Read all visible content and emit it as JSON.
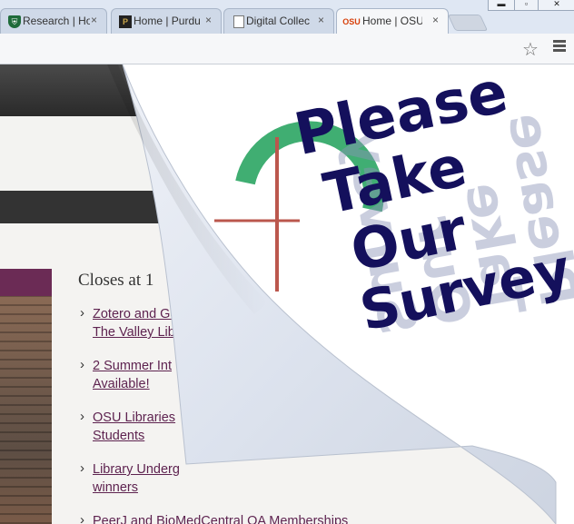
{
  "browser": {
    "tabs": [
      {
        "title": "Research | Ho",
        "icon": "tulane-shield-icon",
        "active": false
      },
      {
        "title": "Home | Purdu",
        "icon": "purdue-p-icon",
        "active": false
      },
      {
        "title": "Digital Collec",
        "icon": "page-icon",
        "active": false
      },
      {
        "title": "Home | OSU",
        "icon_text": "OSU",
        "active": true
      }
    ],
    "tab_close": "×",
    "window_controls": {
      "minimize": "▬",
      "restore": "▫",
      "close": "✕"
    }
  },
  "toolbar": {
    "bookmark_icon": "star-icon",
    "menu_icon": "hamburger-menu-icon"
  },
  "page": {
    "hours_title": "Closes at 1",
    "news_items": [
      {
        "line1": "Zotero and Go",
        "line2": "The Valley Lib"
      },
      {
        "line1": "2 Summer Int",
        "line2": "Available!"
      },
      {
        "line1": "OSU Libraries",
        "line2": "Students"
      },
      {
        "line1": "Library Underg",
        "line2": "winners"
      },
      {
        "line1": "PeerJ and BioMedCentral OA Memberships",
        "line2": ""
      }
    ]
  },
  "survey": {
    "lines": [
      "Please",
      "Take",
      "Our",
      "Survey"
    ],
    "text_color": "#14105c"
  },
  "colors": {
    "osu_maroon": "#5e2350",
    "osu_orange": "#d73f09"
  }
}
